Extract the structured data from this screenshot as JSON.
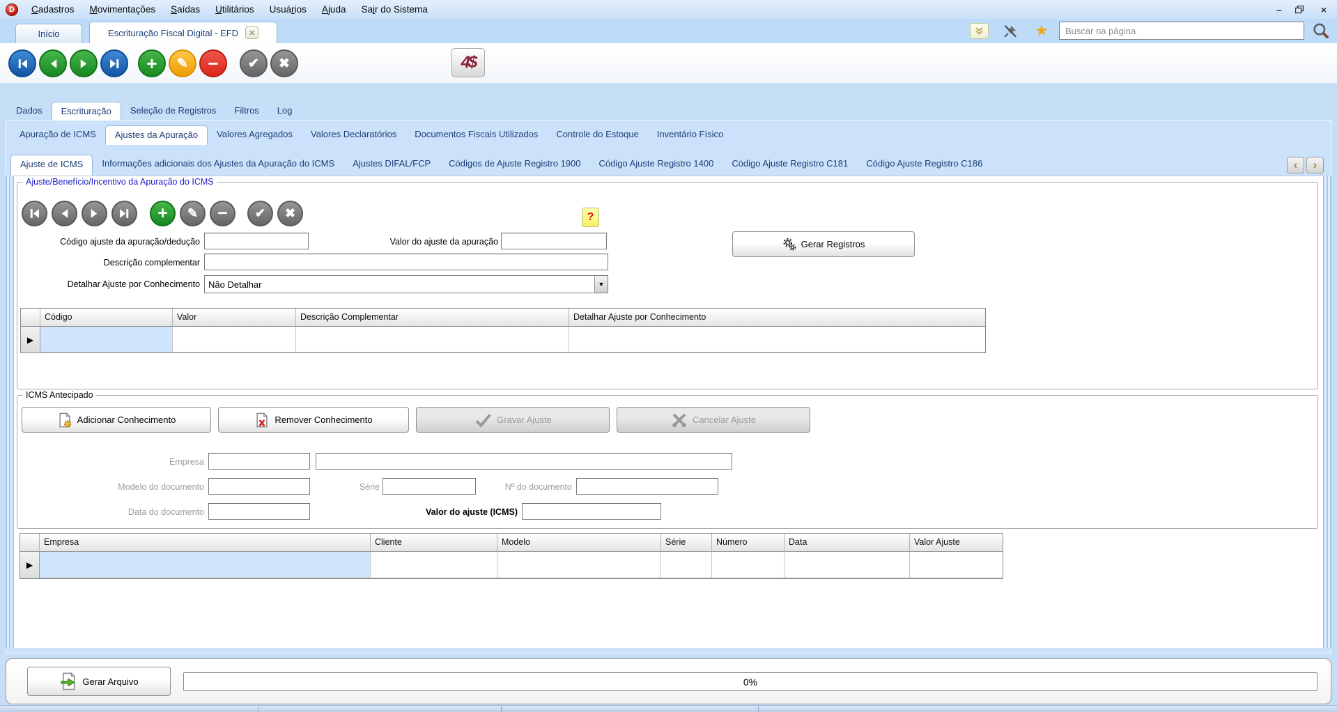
{
  "icons": {
    "logo": "D",
    "minimize": "–",
    "close": "×",
    "tab_close": "✕",
    "star": "★",
    "plus": "+",
    "minus": "−",
    "pencil": "✎",
    "check": "✔",
    "cross": "✖",
    "help": "?",
    "dropdown": "▼",
    "row_selector": "▶",
    "scroll_left": "‹",
    "scroll_right": "›",
    "brand": "4$"
  },
  "colors": {
    "window_bg": "#c6def6",
    "tabstrip_bg": "#bedbfa",
    "tab_text": "#1d3f76",
    "btn_blue": "#1055a4",
    "btn_green": "#168a1f",
    "btn_amber": "#ee9c00",
    "btn_red": "#d8261c",
    "btn_gray": "#6b6b6b",
    "groupbox1_title": "#2222cc",
    "grid_selected_cell": "#cfe5fc",
    "help_bg": "#f7ef6a",
    "help_fg": "#d81818"
  },
  "menubar": {
    "items": [
      {
        "pre": "",
        "key": "C",
        "post": "adastros"
      },
      {
        "pre": "",
        "key": "M",
        "post": "ovimentações"
      },
      {
        "pre": "",
        "key": "S",
        "post": "aídas"
      },
      {
        "pre": "",
        "key": "U",
        "post": "tilitários"
      },
      {
        "pre": "Usuá",
        "key": "r",
        "post": "ios"
      },
      {
        "pre": "",
        "key": "A",
        "post": "juda"
      },
      {
        "pre": "Sa",
        "key": "i",
        "post": "r do Sistema"
      }
    ]
  },
  "doc_tabs": {
    "items": [
      {
        "label": "Início"
      },
      {
        "label": "Escrituração Fiscal Digital - EFD"
      }
    ]
  },
  "search": {
    "placeholder": "Buscar na página"
  },
  "tabs": {
    "level1": [
      "Dados",
      "Escrituração",
      "Seleção de Registros",
      "Filtros",
      "Log"
    ],
    "level2": [
      "Apuração de ICMS",
      "Ajustes da Apuração",
      "Valores Agregados",
      "Valores Declaratórios",
      "Documentos Fiscais Utilizados",
      "Controle do Estoque",
      "Inventário Físico"
    ],
    "level3": [
      "Ajuste de ICMS",
      "Informações adicionais dos Ajustes da Apuração do ICMS",
      "Ajustes DIFAL/FCP",
      "Códigos de Ajuste Registro 1900",
      "Código Ajuste Registro 1400",
      "Código Ajuste Registro C181",
      "Código Ajuste Registro C186"
    ]
  },
  "group1": {
    "title": "Ajuste/Benefício/Incentivo da Apuração do ICMS",
    "labels": {
      "codigo": "Código ajuste da apuração/dedução",
      "valor": "Valor do ajuste da apuração",
      "descricao": "Descrição complementar",
      "detalhar": "Detalhar Ajuste por Conhecimento"
    },
    "detalhar_value": "Não Detalhar",
    "gerar_registros": "Gerar Registros"
  },
  "grid1": {
    "columns": [
      "Código",
      "Valor",
      "Descrição Complementar",
      "Detalhar Ajuste por Conhecimento"
    ]
  },
  "group2": {
    "title": "ICMS Antecipado",
    "buttons": {
      "adicionar": "Adicionar Conhecimento",
      "remover": "Remover Conhecimento",
      "gravar": "Gravar Ajuste",
      "cancelar": "Cancelar Ajuste"
    },
    "labels": {
      "empresa": "Empresa",
      "modelo": "Modelo do documento",
      "serie": "Série",
      "numero_doc": "Nº do documento",
      "data_doc": "Data do documento",
      "valor_icms": "Valor do ajuste (ICMS)"
    }
  },
  "grid2": {
    "columns": [
      "Empresa",
      "Cliente",
      "Modelo",
      "Série",
      "Número",
      "Data",
      "Valor Ajuste"
    ]
  },
  "bottom": {
    "gerar_arquivo": "Gerar Arquivo",
    "progress_label": "0%"
  }
}
